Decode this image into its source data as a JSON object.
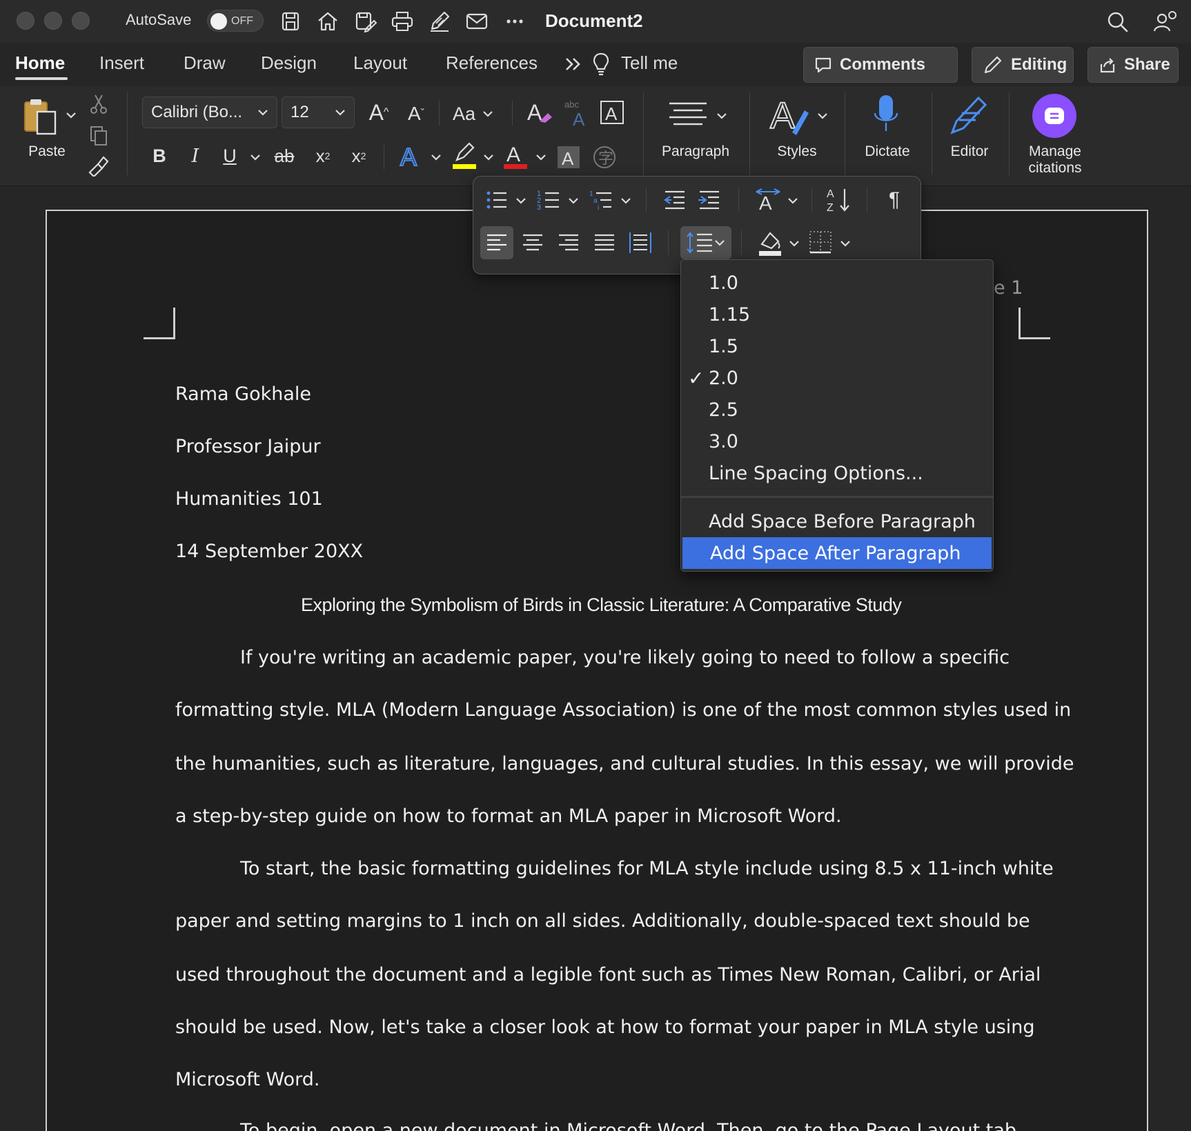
{
  "titlebar": {
    "autosave_label": "AutoSave",
    "autosave_state": "OFF",
    "document_title": "Document2",
    "quick_access_icons": [
      "save-icon",
      "home-icon",
      "save-edit-icon",
      "print-icon",
      "pen-icon",
      "mail-icon",
      "more-icon"
    ]
  },
  "tabs": [
    "Home",
    "Insert",
    "Draw",
    "Design",
    "Layout",
    "References"
  ],
  "tell_me": "Tell me",
  "header_buttons": {
    "comments": "Comments",
    "editing": "Editing",
    "share": "Share"
  },
  "ribbon": {
    "paste": "Paste",
    "font_name": "Calibri (Bo...",
    "font_size": "12",
    "change_case": "Aa",
    "paragraph": "Paragraph",
    "styles": "Styles",
    "dictate": "Dictate",
    "editor": "Editor",
    "manage_citations_line1": "Manage",
    "manage_citations_line2": "citations",
    "colors": {
      "highlight": "#ffff00",
      "font_color": "#e02020",
      "text_effects": "#4b8ef0",
      "citations": "#8a4fff"
    }
  },
  "line_spacing_menu": {
    "items": [
      "1.0",
      "1.15",
      "1.5",
      "2.0",
      "2.5",
      "3.0",
      "Line Spacing Options..."
    ],
    "selected": "2.0",
    "items2": [
      "Add Space Before Paragraph",
      "Add Space After Paragraph"
    ],
    "highlighted": "Add Space After Paragraph",
    "highlight_color": "#3c6fe0"
  },
  "document": {
    "page_number_fragment": "e 1",
    "name": "Rama Gokhale",
    "professor": "Professor Jaipur",
    "course": "Humanities 101",
    "date": "14 September 20XX",
    "title": "Exploring the Symbolism of Birds in Classic Literature: A Comparative Study",
    "lines": [
      "If you're writing an academic paper, you're likely going to need to follow a specific",
      "formatting style. MLA (Modern Language Association) is one of the most common styles used in",
      "the humanities, such as literature, languages, and cultural studies. In this essay, we will provide",
      "a step-by-step guide on how to format an MLA paper in Microsoft Word.",
      "To start, the basic formatting guidelines for MLA style include using 8.5 x 11-inch white",
      "paper and setting margins to 1 inch on all sides. Additionally, double-spaced text should be",
      "used throughout the document and a legible font such as Times New Roman, Calibri, or Arial",
      "should be used. Now, let's take a closer look at how to format your paper in MLA style using",
      "Microsoft Word.",
      "To begin, open a new document in Microsoft Word. Then, go to the Page Layout tab"
    ]
  }
}
